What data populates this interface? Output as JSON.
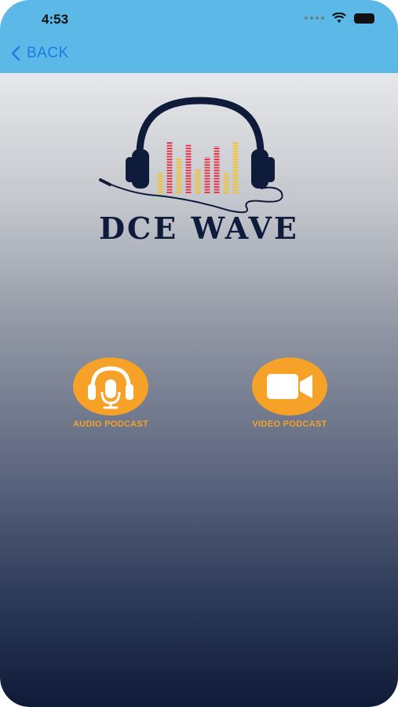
{
  "status_bar": {
    "time": "4:53"
  },
  "nav": {
    "back_label": "BACK"
  },
  "brand": {
    "name": "DCE WAVE"
  },
  "options": {
    "audio": {
      "label": "AUDIO PODCAST"
    },
    "video": {
      "label": "VIDEO PODCAST"
    }
  },
  "colors": {
    "header": "#5cb8e6",
    "back": "#1e7ae6",
    "accent": "#f6a228",
    "brand_text": "#0f1b3a",
    "eq_red": "#e8364a",
    "eq_yellow": "#f2c230"
  },
  "icons": {
    "back": "chevron-left-icon",
    "audio": "headset-microphone-icon",
    "video": "video-camera-icon",
    "logo": "headphones-equalizer-logo"
  }
}
